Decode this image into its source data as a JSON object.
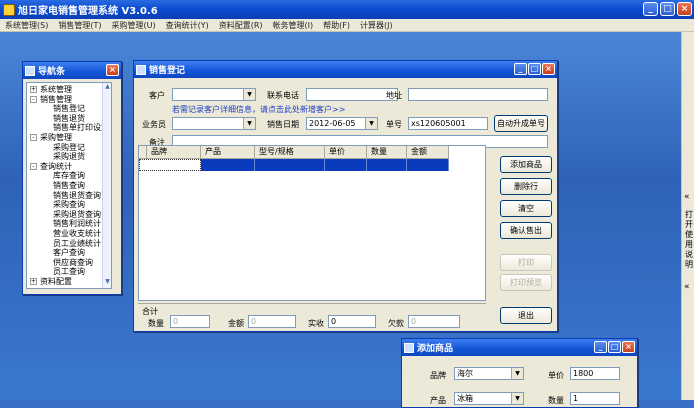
{
  "app": {
    "title": "旭日家电销售管理系统 V3.0.6",
    "controls": [
      "_",
      "□",
      "×"
    ]
  },
  "menu": [
    "系统管理(S)",
    "销售管理(T)",
    "采购管理(U)",
    "查询统计(Y)",
    "资料配置(R)",
    "帐务管理(I)",
    "帮助(F)",
    "计算器(J)"
  ],
  "nav": {
    "title": "导航条",
    "items": [
      {
        "label": "系统管理",
        "indent": 0,
        "box": "+"
      },
      {
        "label": "销售管理",
        "indent": 0,
        "box": "-"
      },
      {
        "label": "销售登记",
        "indent": 1
      },
      {
        "label": "销售退货",
        "indent": 1
      },
      {
        "label": "销售单打印设置",
        "indent": 1
      },
      {
        "label": "采购管理",
        "indent": 0,
        "box": "-"
      },
      {
        "label": "采购登记",
        "indent": 1
      },
      {
        "label": "采购退货",
        "indent": 1
      },
      {
        "label": "查询统计",
        "indent": 0,
        "box": "-"
      },
      {
        "label": "库存查询",
        "indent": 1
      },
      {
        "label": "销售查询",
        "indent": 1
      },
      {
        "label": "销售退货查询",
        "indent": 1
      },
      {
        "label": "采购查询",
        "indent": 1
      },
      {
        "label": "采购退货查询",
        "indent": 1
      },
      {
        "label": "销售利润统计",
        "indent": 1
      },
      {
        "label": "营业收支统计",
        "indent": 1
      },
      {
        "label": "员工业绩统计",
        "indent": 1
      },
      {
        "label": "客户查询",
        "indent": 1
      },
      {
        "label": "供应商查询",
        "indent": 1
      },
      {
        "label": "员工查询",
        "indent": 1
      },
      {
        "label": "资料配置",
        "indent": 0,
        "box": "+"
      }
    ]
  },
  "sales": {
    "title": "销售登记",
    "customer_label": "客户",
    "phone_label": "联系电话",
    "address_label": "地址",
    "link_text": "若需记录客户详细信息，请点击此处新增客户>>",
    "salesman_label": "业务员",
    "date_label": "销售日期",
    "date_value": "2012-06-05",
    "order_label": "单号",
    "order_value": "xs120605001",
    "auto_order_button": "自动升成单号",
    "note_label": "备注",
    "columns": [
      "品牌",
      "产品",
      "型号/规格",
      "单价",
      "数量",
      "金额"
    ],
    "totals_label": "合计",
    "qty_label": "数量",
    "qty_value": "0",
    "amount_label": "金额",
    "amount_value": "0",
    "paid_label": "实收",
    "paid_value": "0",
    "owed_label": "欠款",
    "owed_value": "0",
    "buttons": {
      "add": "添加商品",
      "delete": "删除行",
      "clear": "清空",
      "confirm": "确认售出",
      "print": "打印",
      "preview": "打印预览",
      "exit": "退出"
    }
  },
  "add_product": {
    "title": "添加商品",
    "brand_label": "品牌",
    "brand_value": "海尔",
    "price_label": "单价",
    "price_value": "1800",
    "product_label": "产品",
    "product_value": "冰箱",
    "qty_label": "数量",
    "qty_value": "1"
  },
  "right_panel": {
    "arrow_top": "«",
    "arrow_bottom": "«",
    "label": "打开使用说明"
  }
}
